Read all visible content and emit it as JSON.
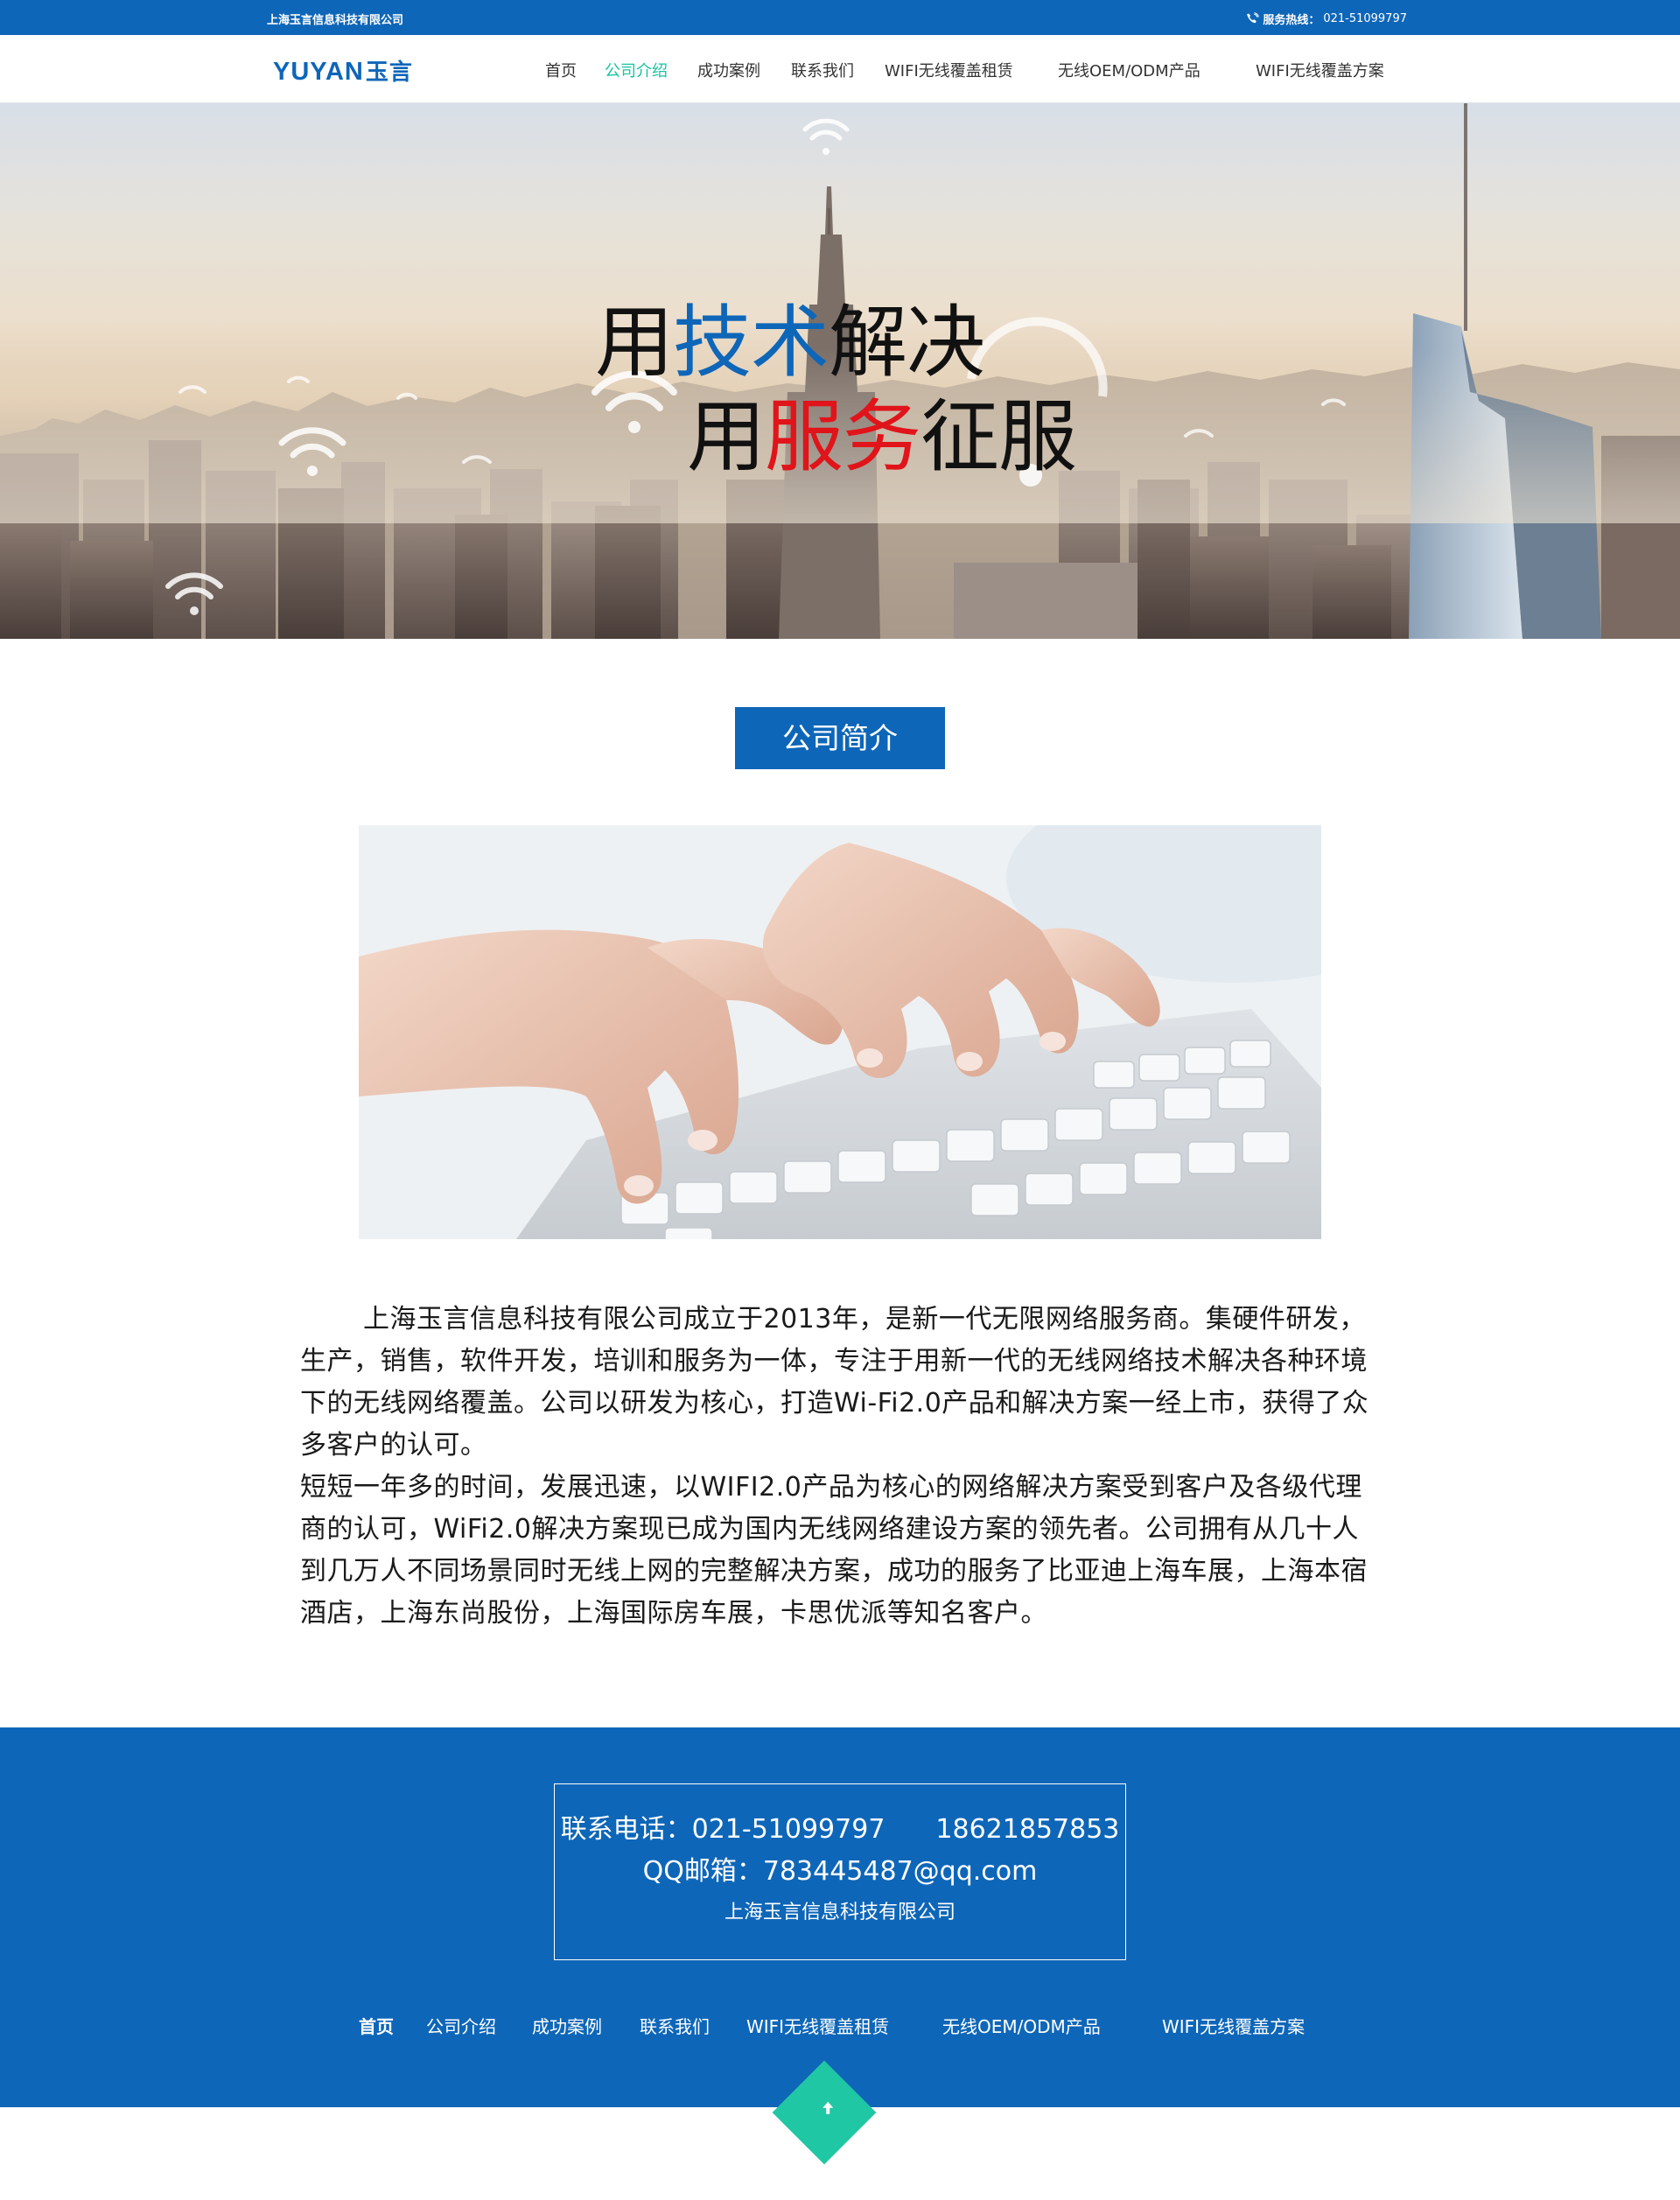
{
  "topbar": {
    "company": "上海玉言信息科技有限公司",
    "hotline_label": "服务热线：",
    "hotline_number": "021-51099797",
    "phone_icon": "phone-icon"
  },
  "nav": {
    "logo_en": "YUYAN",
    "logo_cn": "玉言",
    "items": [
      {
        "label": "首页"
      },
      {
        "label": "公司介绍",
        "active": true
      },
      {
        "label": "成功案例"
      },
      {
        "label": "联系我们"
      },
      {
        "label": "WIFI无线覆盖租赁"
      },
      {
        "label": "无线OEM/ODM产品"
      },
      {
        "label": "WIFI无线覆盖方案"
      }
    ]
  },
  "hero": {
    "line1_a": "用",
    "line1_b": "技术",
    "line1_c": "解决",
    "line2_a": "用",
    "line2_b": "服务",
    "line2_c": "征服",
    "accent_blue": "#0e66b8",
    "accent_red": "#e0141a",
    "icons": [
      "wifi-icon"
    ]
  },
  "section": {
    "title": "公司简介"
  },
  "intro": {
    "paragraph1": "上海玉言信息科技有限公司成立于2013年，是新一代无限网络服务商。集硬件研发，生产，销售，软件开发，培训和服务为一体，专注于用新一代的无线网络技术解决各种环境下的无线网络覆盖。公司以研发为核心，打造Wi-Fi2.0产品和解决方案一经上市，获得了众多客户的认可。",
    "paragraph2": "短短一年多的时间，发展迅速，以WIFI2.0产品为核心的网络解决方案受到客户及各级代理商的认可，WiFi2.0解决方案现已成为国内无线网络建设方案的领先者。公司拥有从几十人到几万人不同场景同时无线上网的完整解决方案，成功的服务了比亚迪上海车展，上海本宿酒店，上海东尚股份，上海国际房车展，卡思优派等知名客户。"
  },
  "footer": {
    "phone_label": "联系电话：",
    "phone1": "021-51099797",
    "phone2": "18621857853",
    "email_label": "QQ邮箱：",
    "email": "783445487@qq.com",
    "company": "上海玉言信息科技有限公司",
    "menu": [
      {
        "label": "首页",
        "active": true
      },
      {
        "label": "公司介绍"
      },
      {
        "label": "成功案例"
      },
      {
        "label": "联系我们"
      },
      {
        "label": "WIFI无线覆盖租赁"
      },
      {
        "label": "无线OEM/ODM产品"
      },
      {
        "label": "WIFI无线覆盖方案"
      }
    ]
  },
  "colors": {
    "brand": "#0e66b8",
    "nav_active": "#17c2a0",
    "back_to_top": "#20c7a4"
  },
  "back_to_top_icon": "arrow-up-icon"
}
